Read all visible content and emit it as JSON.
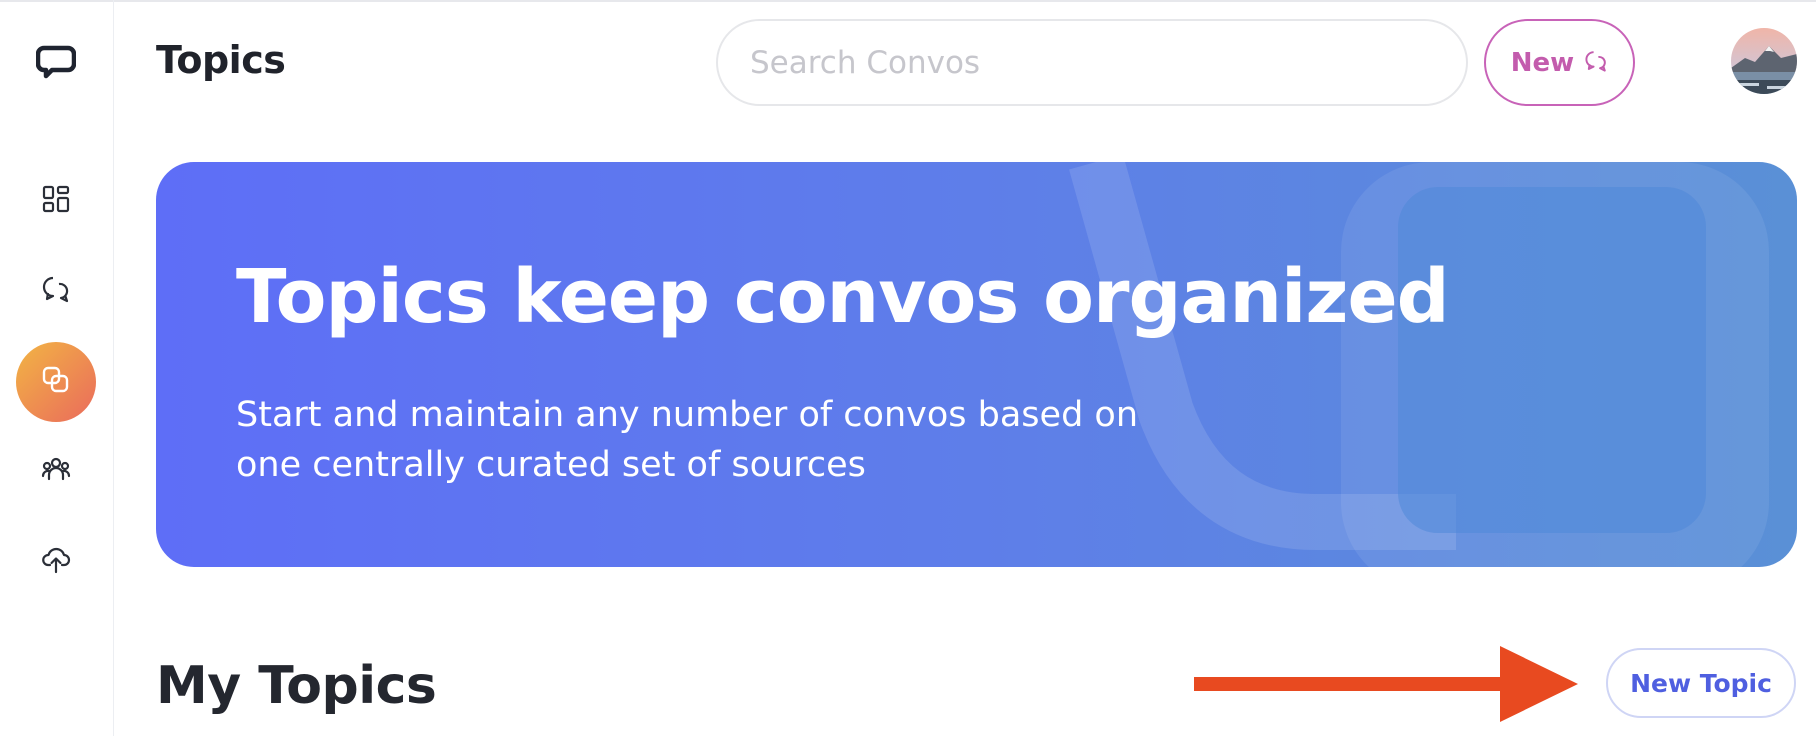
{
  "header": {
    "title": "Topics",
    "search_placeholder": "Search Convos",
    "new_button_label": "New"
  },
  "sidebar": {
    "items": [
      {
        "icon": "dashboard-icon",
        "active": false
      },
      {
        "icon": "chat-bubbles-icon",
        "active": false
      },
      {
        "icon": "topics-icon",
        "active": true
      },
      {
        "icon": "users-icon",
        "active": false
      },
      {
        "icon": "cloud-upload-icon",
        "active": false
      }
    ]
  },
  "banner": {
    "title": "Topics keep convos organized",
    "subtitle": "Start and maintain any number of convos based on one centrally curated set of sources"
  },
  "my_topics": {
    "title": "My Topics",
    "new_topic_label": "New Topic"
  },
  "colors": {
    "accent_pink": "#c35cad",
    "accent_blue": "#4f5fe0",
    "banner_start": "#5e6ef7",
    "banner_end": "#5a90d6",
    "active_nav_start": "#f2b544",
    "active_nav_end": "#ea6a5c",
    "annotation_arrow": "#e84a20"
  }
}
